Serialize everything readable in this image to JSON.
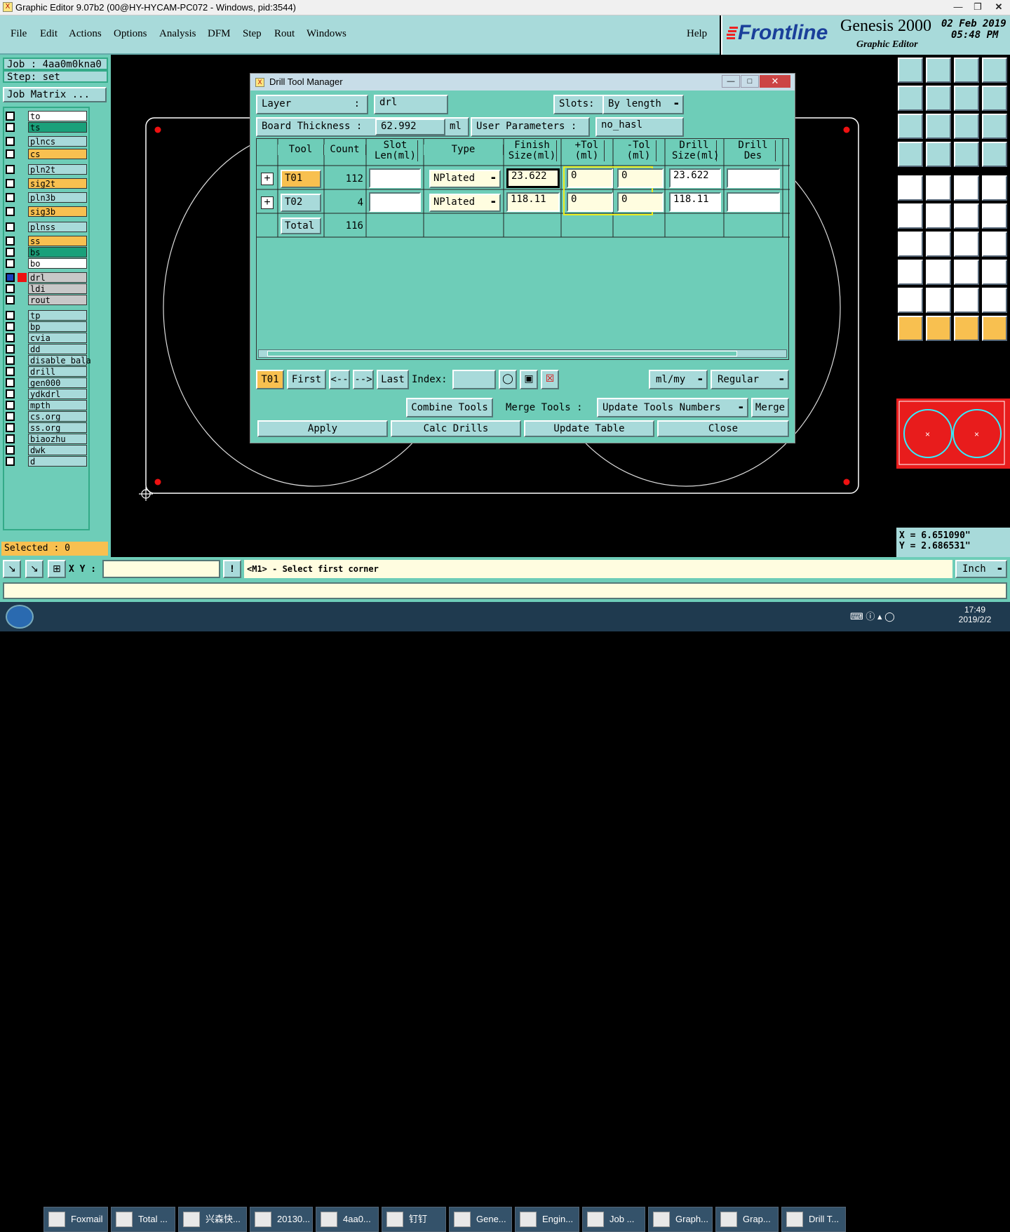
{
  "window": {
    "title": "Graphic Editor 9.07b2 (00@HY-HYCAM-PC072 - Windows, pid:3544)"
  },
  "menu": [
    "File",
    "Edit",
    "Actions",
    "Options",
    "Analysis",
    "DFM",
    "Step",
    "Rout",
    "Windows"
  ],
  "help": "Help",
  "brand": {
    "logo": "Frontline",
    "product": "Genesis 2000",
    "subtitle": "Graphic Editor",
    "date": "02 Feb 2019",
    "time": "05:48 PM"
  },
  "job": {
    "job_label": "Job : 4aa0m0kna0",
    "step_label": "Step: set",
    "matrix_button": "Job Matrix ..."
  },
  "layers": [
    {
      "name": "to",
      "color": "#ffffff"
    },
    {
      "name": "ts",
      "color": "#1aa07a"
    },
    {
      "name": "plncs",
      "color": "#a8dada"
    },
    {
      "name": "cs",
      "color": "#f8c050"
    },
    {
      "name": "pln2t",
      "color": "#a8dada"
    },
    {
      "name": "sig2t",
      "color": "#f8c050"
    },
    {
      "name": "pln3b",
      "color": "#a8dada"
    },
    {
      "name": "sig3b",
      "color": "#f8c050"
    },
    {
      "name": "plnss",
      "color": "#a8dada"
    },
    {
      "name": "ss",
      "color": "#f8c050"
    },
    {
      "name": "bs",
      "color": "#1aa07a"
    },
    {
      "name": "bo",
      "color": "#ffffff"
    },
    {
      "name": "drl",
      "color": "#c8c8c8"
    },
    {
      "name": "ldi",
      "color": "#c8c8c8"
    },
    {
      "name": "rout",
      "color": "#c8c8c8"
    },
    {
      "name": "tp",
      "color": "#a8dada"
    },
    {
      "name": "bp",
      "color": "#a8dada"
    },
    {
      "name": "cvia",
      "color": "#a8dada"
    },
    {
      "name": "dd",
      "color": "#a8dada"
    },
    {
      "name": "disable_bala",
      "color": "#a8dada"
    },
    {
      "name": "drill",
      "color": "#a8dada"
    },
    {
      "name": "gen000",
      "color": "#a8dada"
    },
    {
      "name": "ydkdrl",
      "color": "#a8dada"
    },
    {
      "name": "mpth",
      "color": "#a8dada"
    },
    {
      "name": "cs.org",
      "color": "#a8dada"
    },
    {
      "name": "ss.org",
      "color": "#a8dada"
    },
    {
      "name": "biaozhu",
      "color": "#a8dada"
    },
    {
      "name": "dwk",
      "color": "#a8dada"
    },
    {
      "name": "d",
      "color": "#a8dada"
    }
  ],
  "selected": "Selected : 0",
  "dialog": {
    "title": "Drill Tool Manager",
    "layer_label": "Layer",
    "layer_colon": ":",
    "layer_value": "drl",
    "slots_label": "Slots:",
    "slots_value": "By length",
    "board_thickness_label": "Board Thickness :",
    "board_thickness_value": "62.992",
    "board_unit": "ml",
    "user_params_label": "User Parameters :",
    "user_params_value": "no_hasl",
    "columns": [
      "Tool",
      "Count",
      "Slot Len(ml)",
      "Type",
      "Finish Size(ml)",
      "+Tol (ml)",
      "-Tol (ml)",
      "Drill Size(ml)",
      "Drill Des"
    ],
    "rows": [
      {
        "tool": "T01",
        "count": "112",
        "slot_len": "",
        "type": "NPlated",
        "finish": "23.622",
        "ptol": "0",
        "mtol": "0",
        "drill": "23.622",
        "des": ""
      },
      {
        "tool": "T02",
        "count": "4",
        "slot_len": "",
        "type": "NPlated",
        "finish": "118.11",
        "ptol": "0",
        "mtol": "0",
        "drill": "118.11",
        "des": ""
      }
    ],
    "total_label": "Total",
    "total_count": "116",
    "nav": {
      "current": "T01",
      "first": "First",
      "prev": "<--",
      "next": "-->",
      "last": "Last",
      "index_label": "Index:",
      "units": "ml/my",
      "mode": "Regular"
    },
    "buttons": {
      "combine": "Combine Tools",
      "merge_label": "Merge Tools :",
      "update_numbers": "Update Tools Numbers",
      "merge": "Merge",
      "apply": "Apply",
      "calc": "Calc Drills",
      "update_table": "Update Table",
      "close": "Close"
    }
  },
  "coords": {
    "x": "X = 6.651090\"",
    "y": "Y = 2.686531\""
  },
  "status": {
    "xy_label": "X Y :",
    "message": "<M1> - Select first corner",
    "units": "Inch"
  },
  "taskbar": {
    "items": [
      "Foxmail",
      "Total ...",
      "兴森快...",
      "20130...",
      "4aa0...",
      "钉钉",
      "Gene...",
      "Engin...",
      "Job ...",
      "Graph...",
      "Grap...",
      "Drill T..."
    ],
    "time": "17:49",
    "date": "2019/2/2"
  }
}
